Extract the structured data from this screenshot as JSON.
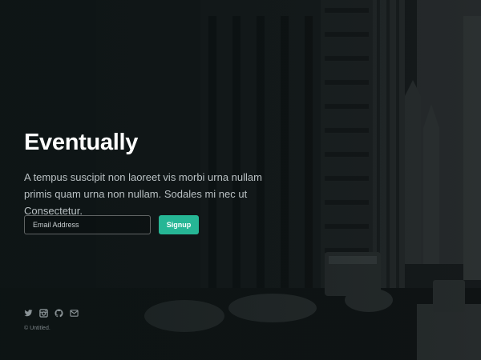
{
  "hero": {
    "title": "Eventually",
    "description": "A tempus suscipit non laoreet vis morbi urna nullam primis quam urna non nullam. Sodales mi nec ut Consectetur."
  },
  "signup_form": {
    "email_placeholder": "Email Address",
    "email_value": "",
    "submit_label": "Signup"
  },
  "footer": {
    "social_icons": [
      "twitter-icon",
      "instagram-icon",
      "github-icon",
      "email-icon"
    ],
    "copyright": "© Untitled."
  },
  "colors": {
    "accent": "#26b695",
    "background": "#15191b",
    "body_text": "#b9c0c3"
  }
}
